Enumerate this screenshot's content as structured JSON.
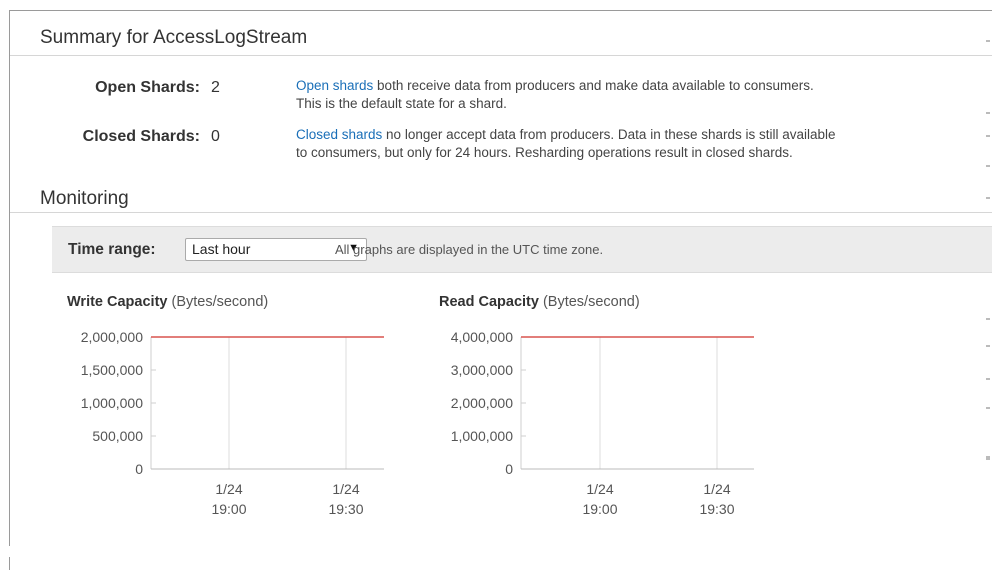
{
  "summary": {
    "title": "Summary for AccessLogStream",
    "open": {
      "label": "Open Shards:",
      "count": "2",
      "link": "Open shards",
      "line1": " both receive data from producers and make data available to consumers.",
      "line2": "This is the default state for a shard."
    },
    "closed": {
      "label": "Closed Shards:",
      "count": "0",
      "link": "Closed shards",
      "line1": " no longer accept data from producers. Data in these shards is still available",
      "line2": "to consumers, but only for 24 hours. Resharding operations result in closed shards."
    }
  },
  "monitoring": {
    "title": "Monitoring",
    "time_range": {
      "label": "Time range:",
      "selected": "Last hour",
      "note": "All graphs are displayed in the UTC time zone."
    }
  },
  "colors": {
    "link": "#1a6fb8",
    "series": "#d9534f",
    "grid": "#dddddd"
  },
  "chart_data": [
    {
      "type": "line",
      "title": "Write Capacity",
      "unit": "(Bytes/second)",
      "y_ticks": [
        "2,000,000",
        "1,500,000",
        "1,000,000",
        "500,000",
        "0"
      ],
      "ylim": [
        0,
        2000000
      ],
      "x_ticks": [
        [
          "1/24",
          "19:00"
        ],
        [
          "1/24",
          "19:30"
        ]
      ],
      "series": [
        {
          "values": [
            2000000,
            2000000
          ]
        }
      ]
    },
    {
      "type": "line",
      "title": "Read Capacity",
      "unit": "(Bytes/second)",
      "y_ticks": [
        "4,000,000",
        "3,000,000",
        "2,000,000",
        "1,000,000",
        "0"
      ],
      "ylim": [
        0,
        4000000
      ],
      "x_ticks": [
        [
          "1/24",
          "19:00"
        ],
        [
          "1/24",
          "19:30"
        ]
      ],
      "series": [
        {
          "values": [
            4000000,
            4000000
          ]
        }
      ]
    }
  ]
}
